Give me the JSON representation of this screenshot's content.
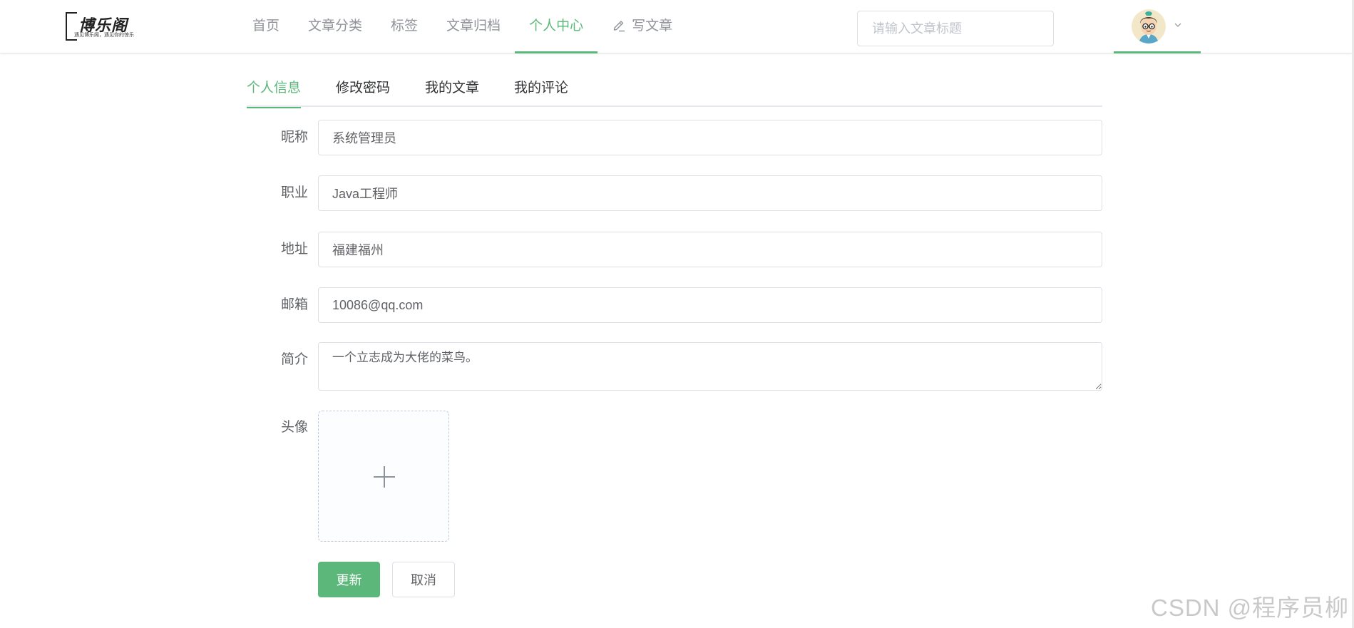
{
  "logo": {
    "title": "博乐阁",
    "slogan": "遇见博乐阁，遇见你的惊乐"
  },
  "nav": {
    "items": [
      {
        "label": "首页"
      },
      {
        "label": "文章分类"
      },
      {
        "label": "标签"
      },
      {
        "label": "文章归档"
      },
      {
        "label": "个人中心",
        "active": true
      },
      {
        "label": "写文章",
        "icon": "pen-icon"
      }
    ]
  },
  "search": {
    "placeholder": "请输入文章标题",
    "value": ""
  },
  "user": {
    "avatar_icon": "avatar-cartoon-icon",
    "dropdown_icon": "chevron-down-icon"
  },
  "tabs": [
    {
      "label": "个人信息",
      "active": true
    },
    {
      "label": "修改密码"
    },
    {
      "label": "我的文章"
    },
    {
      "label": "我的评论"
    }
  ],
  "form": {
    "nickname": {
      "label": "昵称",
      "value": "系统管理员"
    },
    "job": {
      "label": "职业",
      "value": "Java工程师"
    },
    "address": {
      "label": "地址",
      "value": "福建福州"
    },
    "email": {
      "label": "邮箱",
      "value": "10086@qq.com"
    },
    "intro": {
      "label": "简介",
      "value": "一个立志成为大佬的菜鸟。"
    },
    "avatar": {
      "label": "头像",
      "upload_icon": "plus-icon"
    },
    "submit_label": "更新",
    "cancel_label": "取消"
  },
  "watermark": "CSDN @程序员柳",
  "colors": {
    "accent": "#5cb87a",
    "text": "#303133",
    "muted": "#909399",
    "border": "#dcdfe6"
  }
}
